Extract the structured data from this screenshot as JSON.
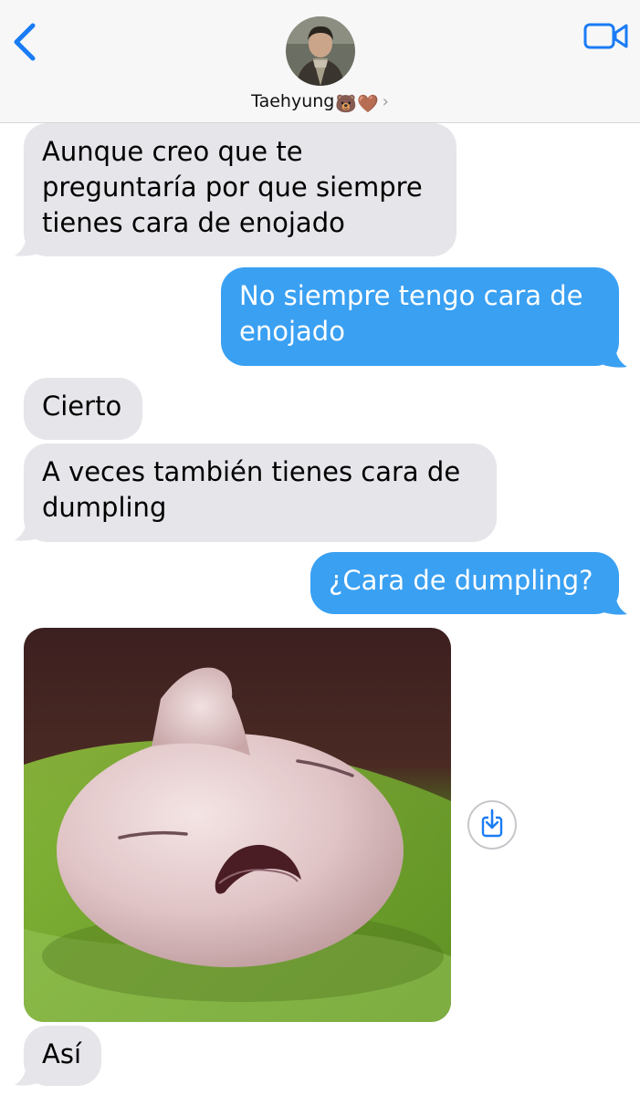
{
  "header": {
    "contact_name": "Taehyung",
    "contact_emojis": "🐻🤎",
    "chevron": "›",
    "icons": [
      "back-chevron-icon",
      "video-camera-icon",
      "contact-avatar"
    ]
  },
  "messages": [
    {
      "direction": "incoming",
      "text": "Aunque creo que te\npreguntaría por que siempre\ntienes cara de enojado"
    },
    {
      "direction": "outgoing",
      "text": "No siempre tengo cara de\nenojado"
    },
    {
      "direction": "incoming",
      "text": "Cierto"
    },
    {
      "direction": "incoming",
      "text": "A veces también tienes cara de\ndumpling"
    },
    {
      "direction": "outgoing",
      "text": "¿Cara de dumpling?"
    },
    {
      "direction": "incoming",
      "type": "image",
      "description_icon": "dumpling-photo"
    },
    {
      "direction": "incoming",
      "text": "Así"
    }
  ],
  "colors": {
    "incoming_bubble": "#e5e5ea",
    "outgoing_bubble": "#3aa0f2",
    "accent": "#1a7cf5"
  }
}
